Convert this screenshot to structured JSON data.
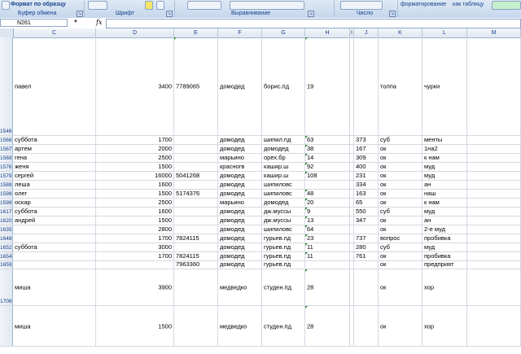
{
  "ribbon": {
    "top_texts": [
      "Формат по образцу",
      "форматирование",
      "как таблицу"
    ],
    "groups": [
      "Буфер обмена",
      "Шрифт",
      "Выравнивание",
      "Число"
    ]
  },
  "formula_bar": {
    "name_box": "N261",
    "fx": "fx",
    "formula": ""
  },
  "columns": [
    "C",
    "D",
    "E",
    "F",
    "G",
    "H",
    "I",
    "J",
    "K",
    "L",
    "M"
  ],
  "rows": [
    {
      "num": "1546",
      "c": "павел",
      "d": "3400",
      "e": "7789065",
      "f": "домодед",
      "g": "борис.пд",
      "h": "19",
      "i": "",
      "j": "",
      "k": "толпа",
      "l": "чурки"
    },
    {
      "num": "1566",
      "c": "суббота",
      "d": "1700",
      "e": "",
      "f": "домодед",
      "g": "шипил.пд",
      "h": "63",
      "i": "",
      "j": "373",
      "k": "суб",
      "l": "менты"
    },
    {
      "num": "1567",
      "c": "артем",
      "d": "2000",
      "e": "",
      "f": "домодед",
      "g": "домодед",
      "h": "38",
      "i": "",
      "j": "167",
      "k": "ок",
      "l": "1на2"
    },
    {
      "num": "1569",
      "c": "гена",
      "d": "2500",
      "e": "",
      "f": "марьино",
      "g": "орех.бр",
      "h": "14",
      "i": "",
      "j": "309",
      "k": "ок",
      "l": "к нам"
    },
    {
      "num": "1576",
      "c": "женя",
      "d": "1500",
      "e": "",
      "f": "красногв",
      "g": "кашир.ш",
      "h": "92",
      "i": "",
      "j": "400",
      "k": "ок",
      "l": "муд"
    },
    {
      "num": "1579",
      "c": "сергей",
      "d": "16000",
      "e": "5041268",
      "f": "домодед",
      "g": "кашир.ш",
      "h": "108",
      "i": "",
      "j": "231",
      "k": "ок",
      "l": "муд"
    },
    {
      "num": "1588",
      "c": "леша",
      "d": "1600",
      "e": "",
      "f": "домодед",
      "g": "шипиловс",
      "h": "",
      "i": "",
      "j": "334",
      "k": "ок",
      "l": "ан"
    },
    {
      "num": "1598",
      "c": "олег",
      "d": "1500",
      "e": "5174376",
      "f": "домодед",
      "g": "шипиловс",
      "h": "48",
      "i": "",
      "j": "163",
      "k": "ок",
      "l": "наш"
    },
    {
      "num": "1599",
      "c": "оскар",
      "d": "2500",
      "e": "",
      "f": "марьино",
      "g": "домодед",
      "h": "20",
      "i": "",
      "j": "65",
      "k": "ок",
      "l": "к нам"
    },
    {
      "num": "1617",
      "c": "суббота",
      "d": "1600",
      "e": "",
      "f": "домодед",
      "g": "дж.муссы",
      "h": "9",
      "i": "",
      "j": "550",
      "k": "суб",
      "l": "муд"
    },
    {
      "num": "1620",
      "c": "андрей",
      "d": "1500",
      "e": "",
      "f": "домодед",
      "g": "дж.муссы",
      "h": "13",
      "i": "",
      "j": "347",
      "k": "ок",
      "l": "ан"
    },
    {
      "num": "1635",
      "c": "",
      "d": "2800",
      "e": "",
      "f": "домодед",
      "g": "шипиловс",
      "h": "64",
      "i": "",
      "j": "",
      "k": "ок",
      "l": "2-е муд"
    },
    {
      "num": "1648",
      "c": "",
      "d": "1700",
      "e": "7824115",
      "f": "домодед",
      "g": "гурьев.пд",
      "h": "23",
      "i": "",
      "j": "737",
      "k": "вопрос",
      "l": "пробивка"
    },
    {
      "num": "1652",
      "c": "суббота",
      "d": "3000",
      "e": "",
      "f": "домодед",
      "g": "гурьев.пд",
      "h": "11",
      "i": "",
      "j": "280",
      "k": "суб",
      "l": "муд"
    },
    {
      "num": "1654",
      "c": "",
      "d": "1700",
      "e": "7824115",
      "f": "домодед",
      "g": "гурьев.пд",
      "h": "11",
      "i": "",
      "j": "761",
      "k": "ок",
      "l": "пробивка"
    },
    {
      "num": "1659",
      "c": "",
      "d": "",
      "e": "7963360",
      "f": "домодед",
      "g": "гурьев.пд",
      "h": "",
      "i": "",
      "j": "",
      "k": "ок",
      "l": "предприят"
    },
    {
      "num": "1708",
      "c": "миша",
      "d": "3900",
      "e": "",
      "f": "медведко",
      "g": "студен.пд",
      "h": "28",
      "i": "",
      "j": "",
      "k": "ок",
      "l": "хор"
    },
    {
      "num": "",
      "c": "миша",
      "d": "1500",
      "e": "",
      "f": "медведко",
      "g": "студен.пд",
      "h": "28",
      "i": "",
      "j": "",
      "k": "ок",
      "l": "хор"
    }
  ]
}
